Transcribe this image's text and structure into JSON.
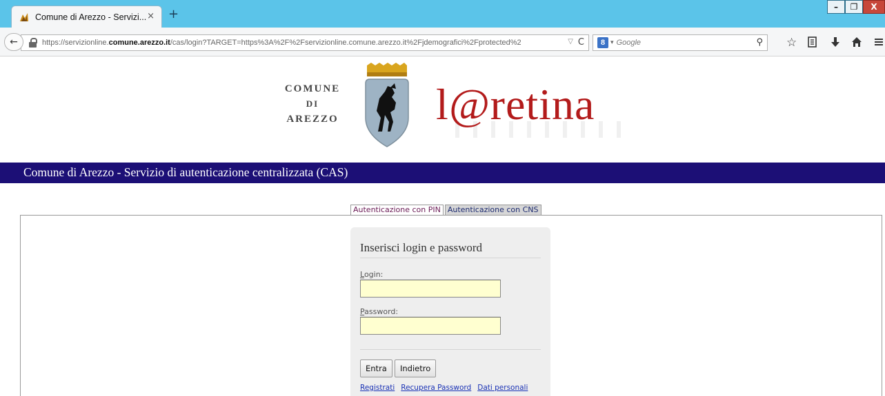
{
  "browser": {
    "tab_title": "Comune di Arezzo - Servizi...",
    "tab_close": "×",
    "new_tab": "+",
    "url_prefix": "https://servizionline.",
    "url_domain": "comune.arezzo.it",
    "url_rest": "/cas/login?TARGET=https%3A%2F%2Fservizionline.comune.arezzo.it%2Fjdemografici%2Fprotected%2",
    "search_placeholder": "Google",
    "search_engine_badge": "8",
    "icons": [
      "back-icon",
      "lock-icon",
      "reload-icon",
      "search-icon",
      "bookmark-star-icon",
      "reading-list-icon",
      "download-icon",
      "home-icon",
      "menu-icon"
    ],
    "window_buttons": {
      "minimize": "–",
      "restore": "❐",
      "close": "X"
    }
  },
  "page": {
    "logo_comune": {
      "line1": "COMUNE",
      "line2": "DI",
      "line3": "AREZZO"
    },
    "brand": {
      "prefix": "l",
      "at": "@",
      "suffix": "retina"
    },
    "header_title": "Comune di Arezzo - Servizio di autenticazione centralizzata (CAS)",
    "tabs": [
      {
        "label": "Autenticazione con PIN",
        "active": true
      },
      {
        "label": "Autenticazione con CNS",
        "active": false
      }
    ],
    "login": {
      "title": "Inserisci login e password",
      "login_label_first": "L",
      "login_label_rest": "ogin:",
      "login_value": "",
      "password_label_first": "P",
      "password_label_rest": "assword:",
      "password_value": "",
      "submit_label": "Entra",
      "back_label": "Indietro",
      "links": [
        "Registrati",
        "Recupera Password",
        "Dati personali"
      ]
    }
  },
  "colors": {
    "header_band": "#1c0f76",
    "brand_red": "#b31b1b",
    "input_bg": "#ffffd0",
    "link": "#1830b4",
    "titlebar": "#5bc4e9"
  }
}
